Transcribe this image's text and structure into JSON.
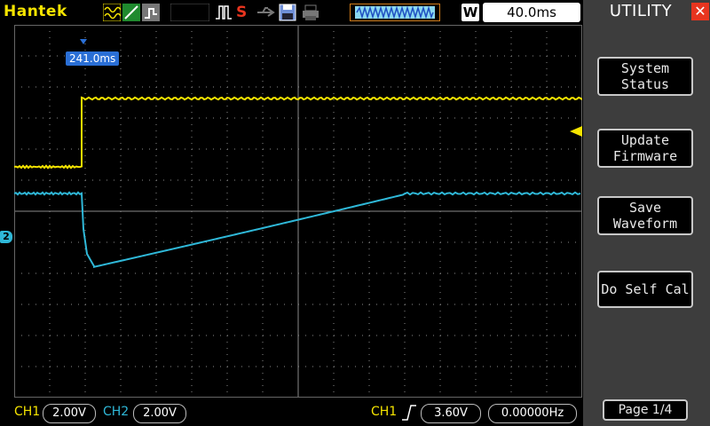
{
  "brand": "Hantek",
  "timebase": "40.0ms",
  "w_label": "W",
  "trigger_time": "241.0ms",
  "ch2_marker": "2",
  "bottom": {
    "ch1_label": "CH1",
    "ch1_scale": "2.00V",
    "ch2_label": "CH2",
    "ch2_scale": "2.00V",
    "trig_source": "CH1",
    "trig_level": "3.60V",
    "frequency": "0.00000Hz"
  },
  "menu": {
    "title": "UTILITY",
    "buttons": [
      "System\nStatus",
      "Update\nFirmware",
      "Save\nWaveform",
      "Do Self Cal"
    ],
    "page": "Page 1/4"
  },
  "icons": [
    "wave-icon",
    "acquire-icon",
    "slope-icon",
    "pulse-icon",
    "run-stop-icon",
    "usb-icon",
    "save-icon",
    "print-icon",
    "buffer-icon"
  ],
  "colors": {
    "ch1": "#f5e400",
    "ch2": "#2fb8d8",
    "grid": "#8a8a8a",
    "menu_bg": "#3d3d3d",
    "trigger_flag": "#2a6fd6"
  }
}
